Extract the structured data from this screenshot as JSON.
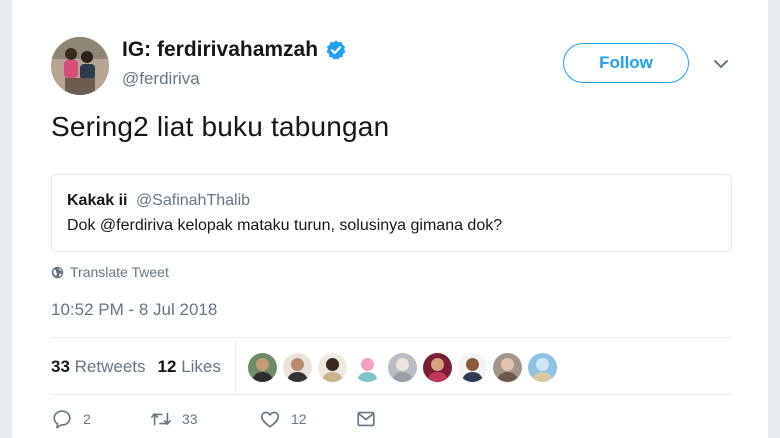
{
  "author": {
    "display_name": "IG: ferdirivahamzah",
    "username": "@ferdiriva",
    "verified": true
  },
  "follow_button": {
    "label": "Follow"
  },
  "tweet": {
    "text": "Sering2 liat buku tabungan",
    "timestamp": "10:52 PM - 8 Jul 2018"
  },
  "quote": {
    "name": "Kakak ii",
    "handle": "@SafinahThalib",
    "text": "Dok @ferdiriva kelopak mataku turun, solusinya gimana dok?"
  },
  "translate": {
    "label": "Translate Tweet"
  },
  "stats": {
    "retweets_count": "33",
    "retweets_label": "Retweets",
    "likes_count": "12",
    "likes_label": "Likes"
  },
  "actions": {
    "reply_count": "2",
    "retweet_count": "33",
    "like_count": "12"
  },
  "colors": {
    "accent": "#1da1f2",
    "muted": "#657786",
    "text": "#14171a",
    "border": "#e1e8ed"
  }
}
